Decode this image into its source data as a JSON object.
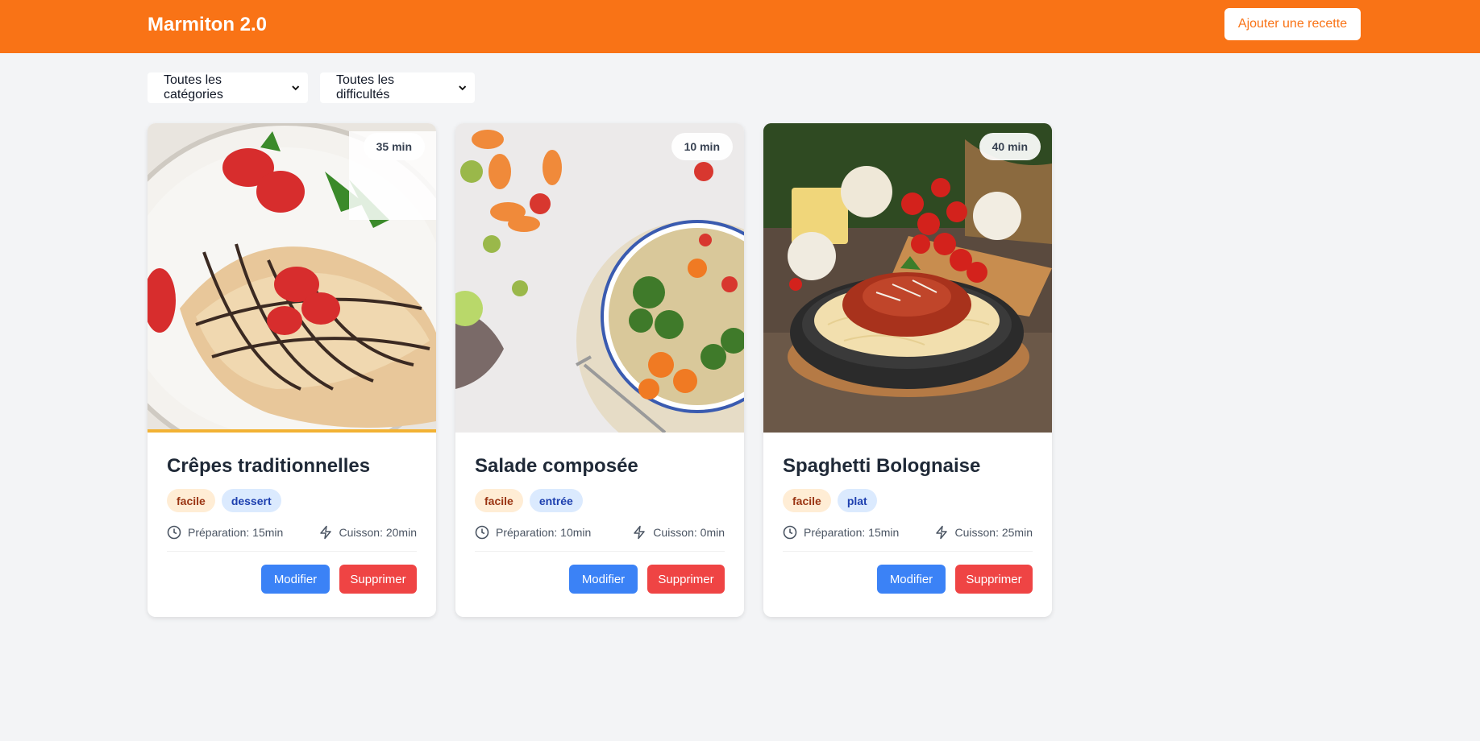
{
  "header": {
    "brand": "Marmiton 2.0",
    "add_button": "Ajouter une recette"
  },
  "filters": {
    "category": "Toutes les catégories",
    "difficulty": "Toutes les difficultés"
  },
  "recipes": [
    {
      "title": "Crêpes traditionnelles",
      "time": "35 min",
      "difficulty": "facile",
      "category": "dessert",
      "prep": "Préparation: 15min",
      "cook": "Cuisson: 20min",
      "edit": "Modifier",
      "delete": "Supprimer"
    },
    {
      "title": "Salade composée",
      "time": "10 min",
      "difficulty": "facile",
      "category": "entrée",
      "prep": "Préparation: 10min",
      "cook": "Cuisson: 0min",
      "edit": "Modifier",
      "delete": "Supprimer"
    },
    {
      "title": "Spaghetti Bolognaise",
      "time": "40 min",
      "difficulty": "facile",
      "category": "plat",
      "prep": "Préparation: 15min",
      "cook": "Cuisson: 25min",
      "edit": "Modifier",
      "delete": "Supprimer"
    }
  ],
  "icons": {
    "chevron": "chevron-down-icon",
    "clock": "clock-icon",
    "cook": "lightning-icon"
  },
  "colors": {
    "brand": "#f97316",
    "edit": "#3b82f6",
    "delete": "#ef4444"
  }
}
